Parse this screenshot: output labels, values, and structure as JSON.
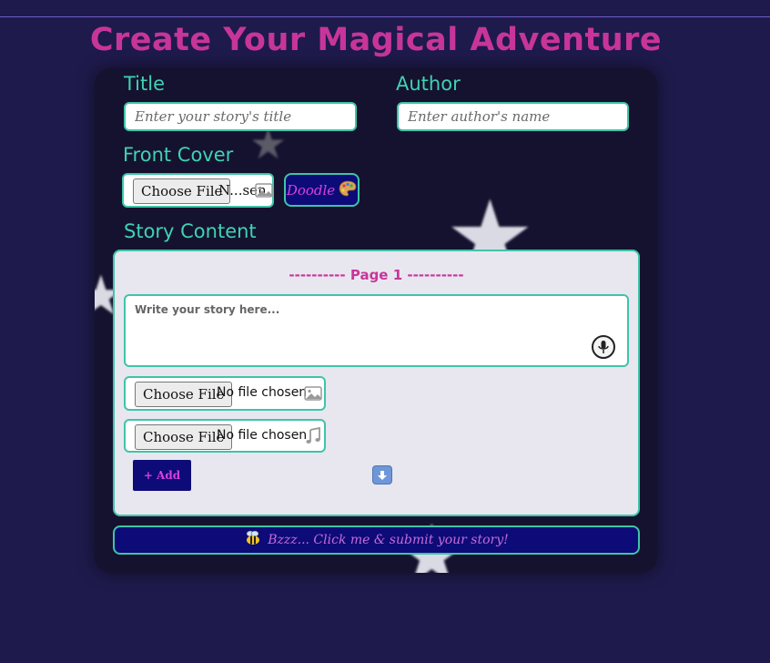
{
  "header": {
    "title": "Create Your Magical Adventure"
  },
  "form": {
    "title_label": "Title",
    "title_placeholder": "Enter your story's title",
    "author_label": "Author",
    "author_placeholder": "Enter author's name",
    "cover_label": "Front Cover",
    "cover_choose_label": "Choose File",
    "cover_file_status": "N...sen",
    "cover_icon": "image-icon",
    "doodle_label": "Doodle",
    "doodle_icon": "palette-icon",
    "content_label": "Story Content"
  },
  "page": {
    "heading": "---------- Page 1 ----------",
    "text_placeholder": "Write your story here...",
    "mic_icon": "microphone-icon",
    "image_choose_label": "Choose File",
    "image_file_status": "No file chosen",
    "image_icon": "image-icon",
    "audio_choose_label": "Choose File",
    "audio_file_status": "No file chosen",
    "audio_icon": "music-note-icon",
    "add_label": "+ Add",
    "down_icon": "down-arrow-icon"
  },
  "submit": {
    "label": "Bzzz... Click me & submit your story!",
    "icon": "bee-icon"
  },
  "colors": {
    "background": "#1e1a4b",
    "title": "#c8359a",
    "label": "#3fd2b3",
    "border": "#3fc4a8",
    "button_bg": "#0d0b78",
    "button_text": "#d840e0",
    "panel_bg": "#e8e7ef"
  }
}
